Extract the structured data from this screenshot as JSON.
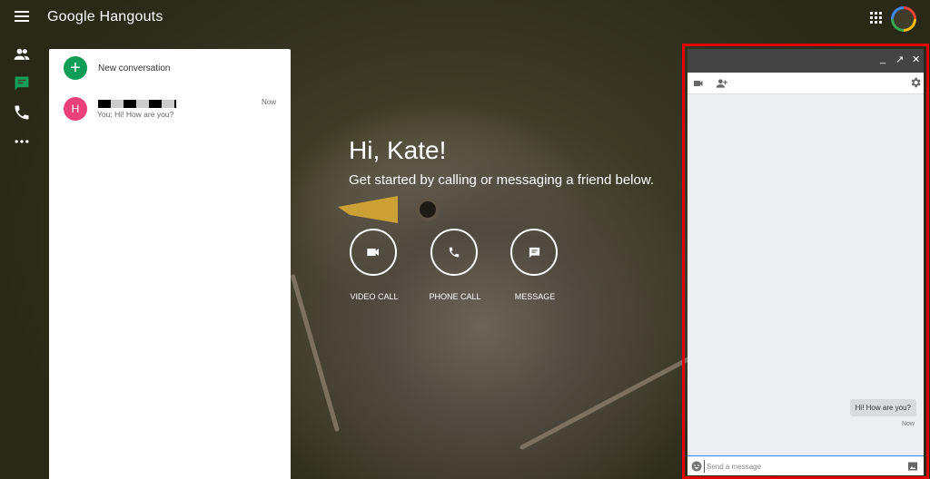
{
  "app": {
    "title": "Google Hangouts"
  },
  "conversations": {
    "new_label": "New conversation",
    "items": [
      {
        "avatar_initial": "H",
        "preview": "You: Hi! How are you?",
        "time": "Now",
        "avatar_color": "#ec407a"
      }
    ]
  },
  "greeting": {
    "title": "Hi, Kate!",
    "subtitle": "Get started by calling or messaging a friend below."
  },
  "actions": [
    {
      "label": "VIDEO CALL",
      "icon": "video-camera-icon"
    },
    {
      "label": "PHONE CALL",
      "icon": "phone-icon"
    },
    {
      "label": "MESSAGE",
      "icon": "message-icon"
    }
  ],
  "chat": {
    "messages": [
      {
        "text": "Hi! How are you?",
        "time": "Now"
      }
    ],
    "input_placeholder": "Send a message"
  },
  "colors": {
    "accent_green": "#0f9d58",
    "highlight_border": "#e00000"
  }
}
